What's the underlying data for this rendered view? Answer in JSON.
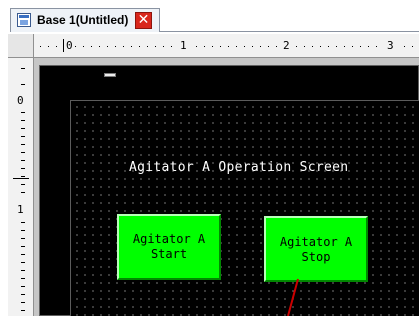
{
  "tab": {
    "icon": "screen-document-icon",
    "title": "Base 1(Untitled)",
    "close_glyph": "✕",
    "close_icon": "close-icon"
  },
  "ruler": {
    "horizontal_labels": [
      "0",
      "1",
      "2",
      "3"
    ],
    "vertical_labels": [
      "0",
      "1"
    ]
  },
  "screen": {
    "title": "Agitator A Operation Screen",
    "buttons": [
      {
        "line1": "Agitator A",
        "line2": "Start"
      },
      {
        "line1": "Agitator A",
        "line2": "Stop"
      }
    ]
  },
  "colors": {
    "screen_background": "#000000",
    "button_fill": "#00ff00",
    "close_button": "#d9261c",
    "pointer_line": "#cc0000"
  }
}
